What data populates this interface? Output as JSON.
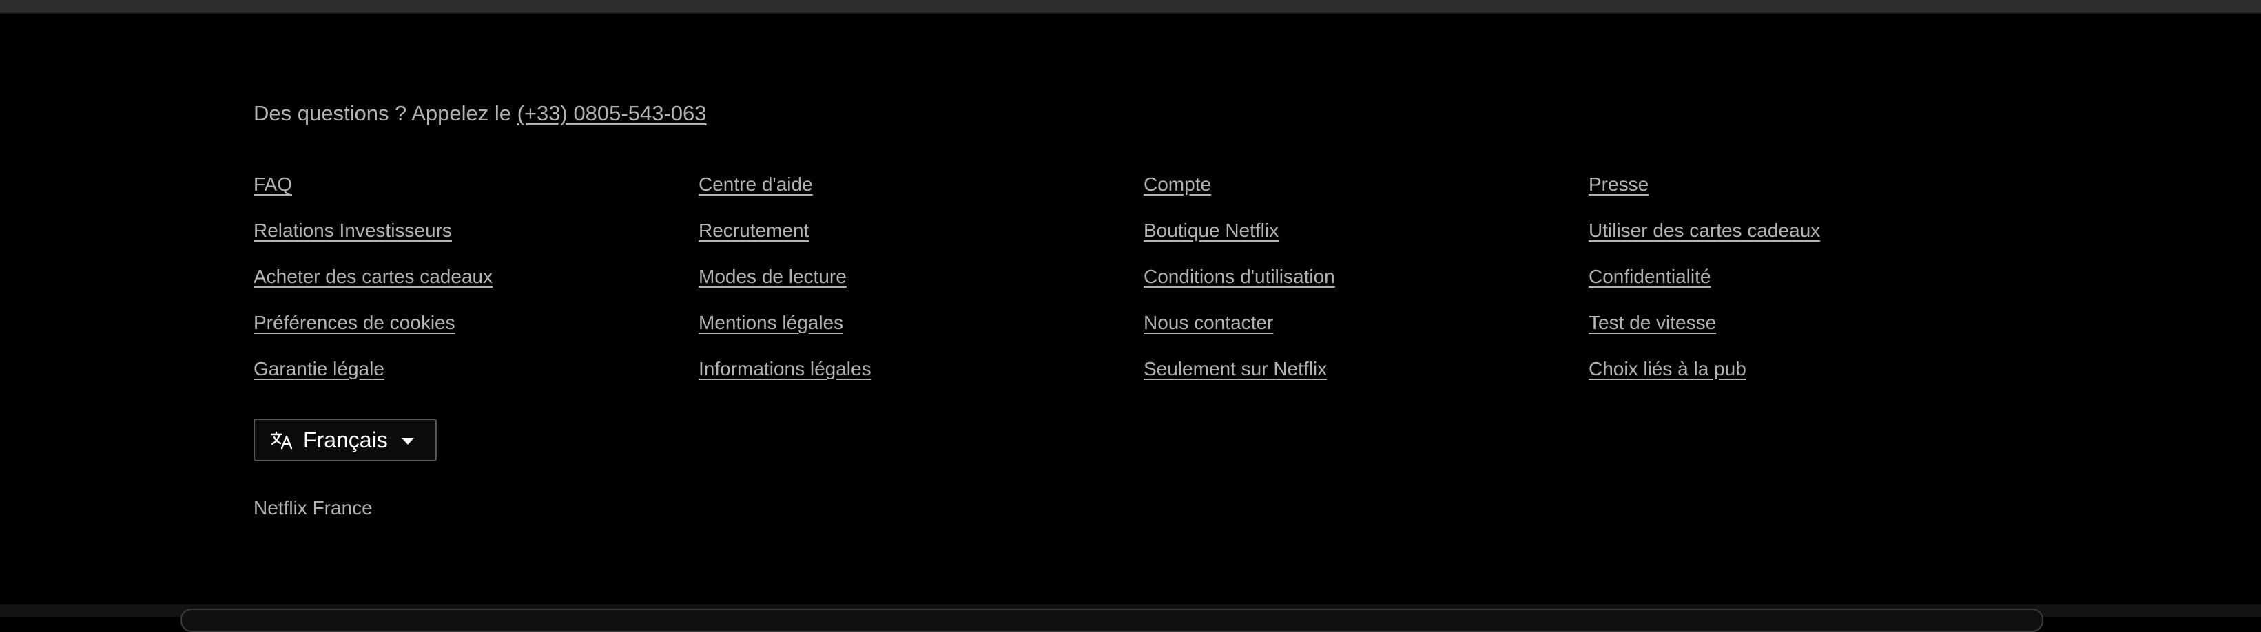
{
  "footer": {
    "questions_prefix": "Des questions ? Appelez le ",
    "phone": "(+33) 0805-543-063",
    "links": [
      "FAQ",
      "Centre d'aide",
      "Compte",
      "Presse",
      "Relations Investisseurs",
      "Recrutement",
      "Boutique Netflix",
      "Utiliser des cartes cadeaux",
      "Acheter des cartes cadeaux",
      "Modes de lecture",
      "Conditions d'utilisation",
      "Confidentialité",
      "Préférences de cookies",
      "Mentions légales",
      "Nous contacter",
      "Test de vitesse",
      "Garantie légale",
      "Informations légales",
      "Seulement sur Netflix",
      "Choix liés à la pub"
    ],
    "language": {
      "icon": "language-icon",
      "selected": "Français"
    },
    "country": "Netflix France"
  },
  "colors": {
    "background": "#000000",
    "link": "#b3b3b3",
    "language_text": "#ffffff",
    "language_border": "#5a5a5a"
  }
}
